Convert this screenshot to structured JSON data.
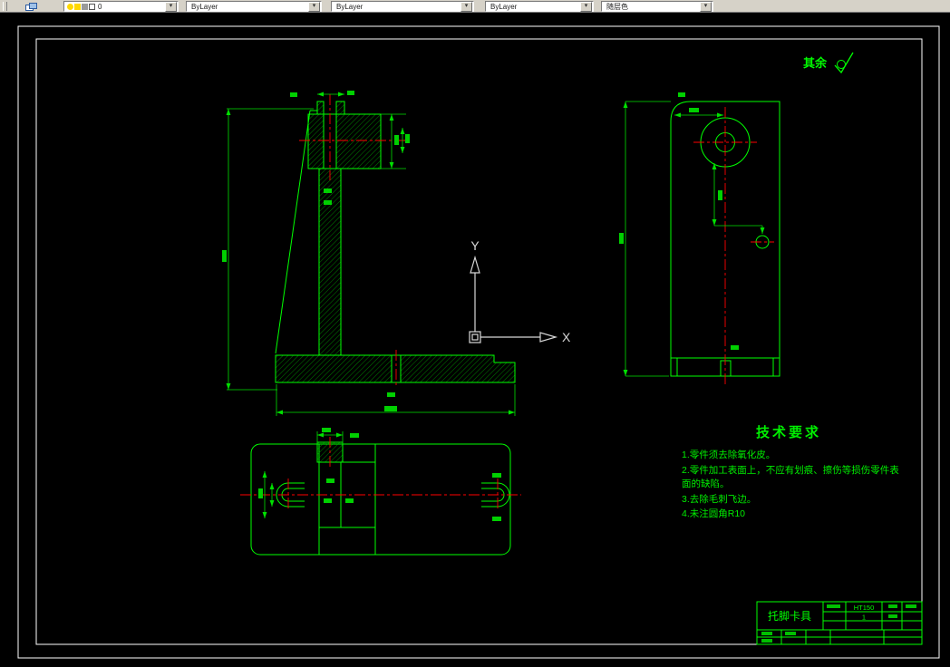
{
  "toolbar": {
    "combos": [
      {
        "id": "layer",
        "value": "0"
      },
      {
        "id": "color",
        "value": "ByLayer"
      },
      {
        "id": "linetype",
        "value": "ByLayer"
      },
      {
        "id": "lineweight",
        "value": "ByLayer"
      },
      {
        "id": "plot_style",
        "value": "随层色"
      }
    ]
  },
  "drawing": {
    "colors": {
      "geometry": "#00ff00",
      "centerline": "#ff0000",
      "frame": "#ffffff",
      "ucs": "#d8d8d8",
      "background": "#000000"
    },
    "surface_note": {
      "text": "其余",
      "symbol": "roughness-check"
    },
    "ucs": {
      "x_label": "X",
      "y_label": "Y"
    },
    "tech_requirements": {
      "title": "技术要求",
      "items": [
        "1.零件须去除氧化皮。",
        "2.零件加工表面上，不应有划痕、擦伤等损伤零件表面的缺陷。",
        "3.去除毛刺飞边。",
        "4.未注圆角R10"
      ]
    },
    "title_block": {
      "part_name": "托脚卡具",
      "material": "HT150",
      "quantity": "1"
    }
  }
}
